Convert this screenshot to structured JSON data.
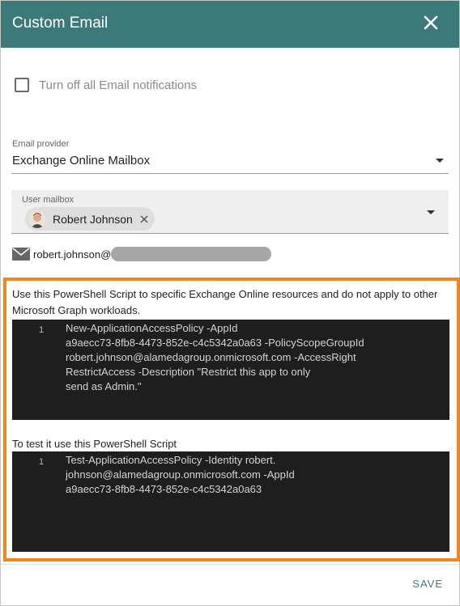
{
  "dialog": {
    "title": "Custom Email",
    "close_icon": "close-icon",
    "header_color": "#3c7a7a"
  },
  "notifications": {
    "checkbox_label": "Turn off all Email notifications",
    "checked": false
  },
  "provider": {
    "label": "Email provider",
    "value": "Exchange Online Mailbox"
  },
  "mailbox": {
    "label": "User mailbox",
    "selected_user": "Robert Johnson"
  },
  "email": {
    "icon": "mail-icon",
    "visible_prefix": "robert.johnson@"
  },
  "script_section": {
    "description": "Use this PowerShell Script to specific Exchange Online resources and do not apply to other Microsoft Graph workloads.",
    "script_line_number": "1",
    "script_lines": [
      "New-ApplicationAccessPolicy -AppId",
      "a9aecc73-8fb8-4473-852e-c4c5342a0a63 -PolicyScopeGroupId",
      "robert.johnson@alamedagroup.onmicrosoft.com -AccessRight",
      "RestrictAccess -Description \"Restrict this app to only",
      "send as Admin.\""
    ],
    "test_label": "To test it use this PowerShell Script",
    "test_line_number": "1",
    "test_lines": [
      "Test-ApplicationAccessPolicy -Identity robert.",
      "johnson@alamedagroup.onmicrosoft.com -AppId",
      "a9aecc73-8fb8-4473-852e-c4c5342a0a63"
    ],
    "highlight_color": "#f5841f"
  },
  "footer": {
    "save_label": "SAVE"
  }
}
